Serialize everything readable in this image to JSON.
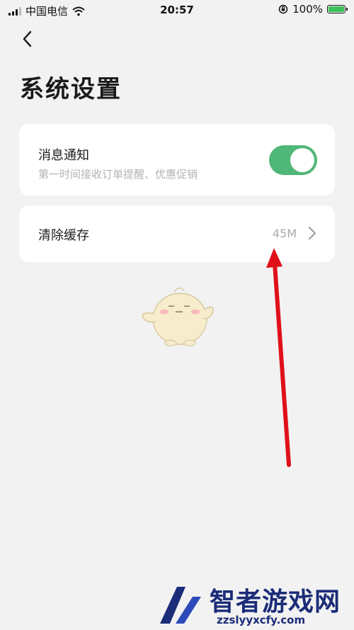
{
  "status_bar": {
    "carrier": "中国电信",
    "time": "20:57",
    "battery": "100%"
  },
  "header": {
    "back_icon": "chevron-left-icon",
    "title": "系统设置"
  },
  "settings": {
    "notification": {
      "title": "消息通知",
      "subtitle": "第一时间接收订单提醒、优惠促销",
      "enabled": true,
      "toggle_color": "#4fb777"
    },
    "cache": {
      "title": "清除缓存",
      "size": "45M",
      "chevron_icon": "chevron-right-icon"
    }
  },
  "watermark": {
    "name": "智者游戏网",
    "url": "zzslyyxcfy.com"
  },
  "colors": {
    "background": "#f2f2f2",
    "card": "#ffffff",
    "annotation_arrow": "#e0101a"
  }
}
